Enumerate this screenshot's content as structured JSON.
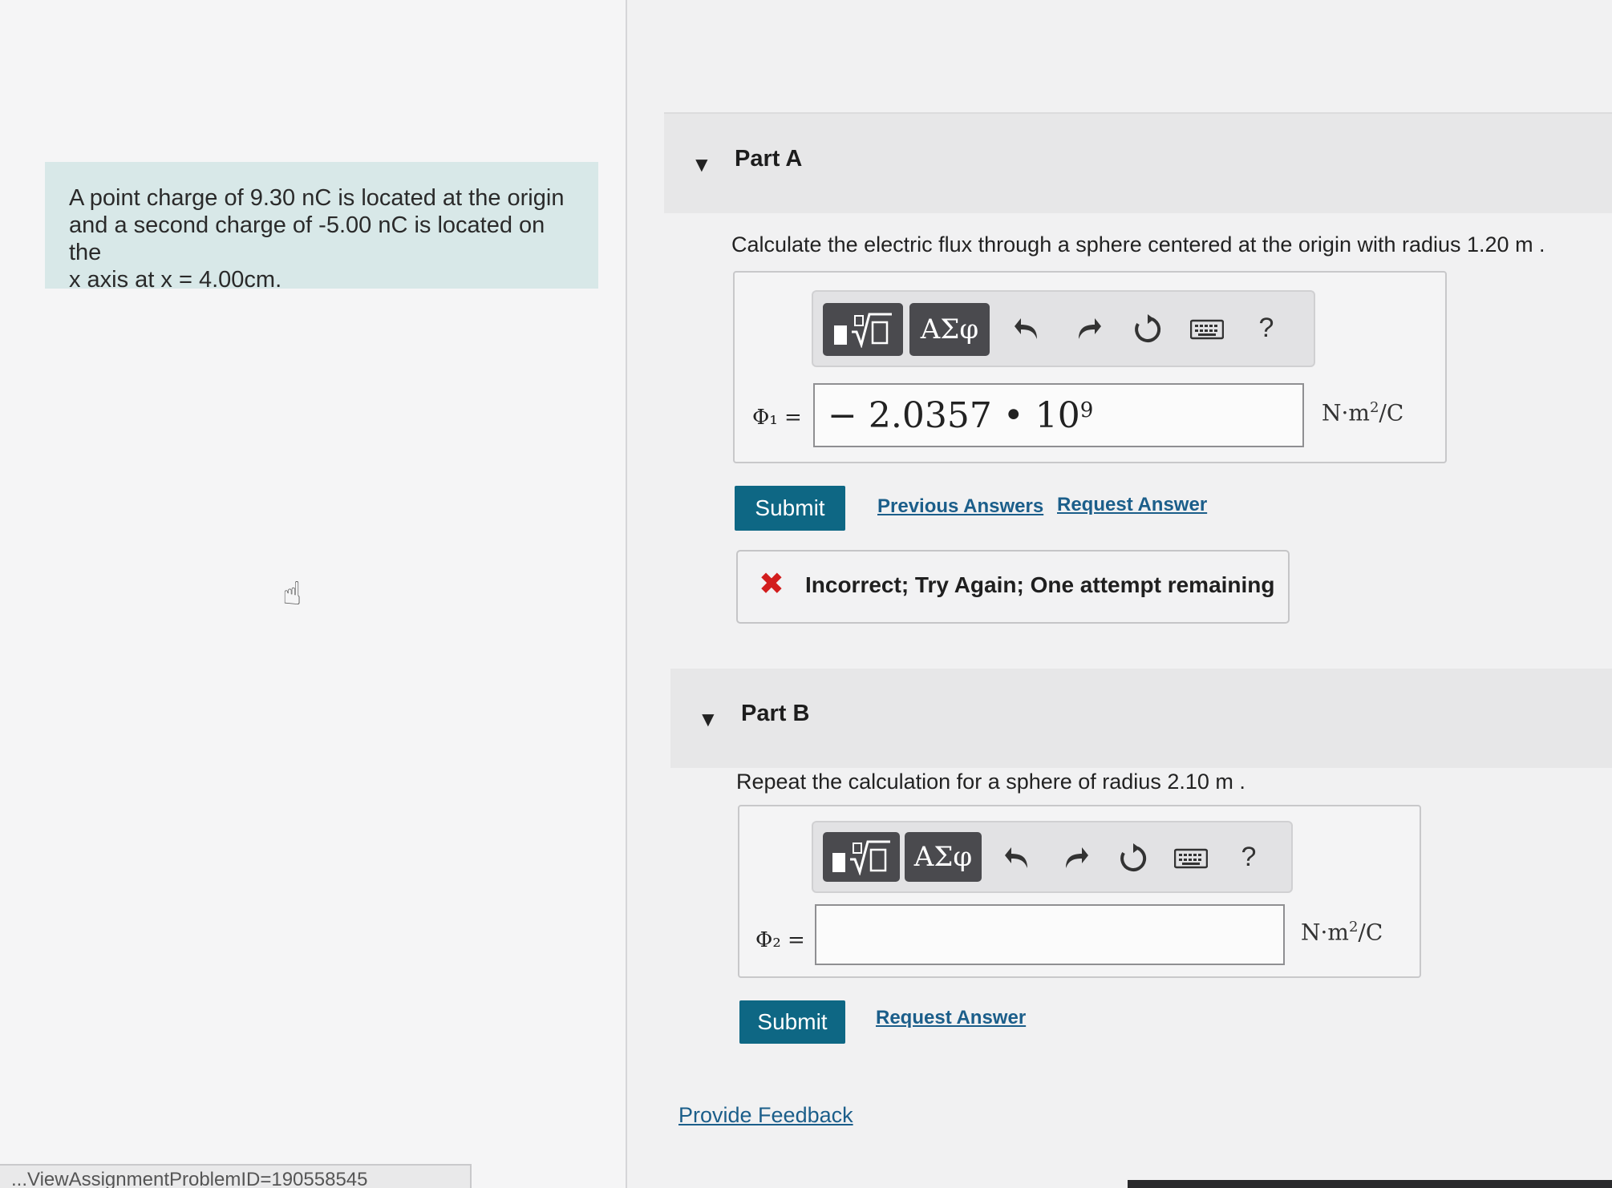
{
  "problem": {
    "line1": "A point charge of 9.30 nC is located at the origin",
    "line2": "and a second charge of -5.00 nC is located on the",
    "line3": "x axis at x = 4.00cm."
  },
  "url_fragment": "...ViewAssignmentProblemID=190558545",
  "toolbar": {
    "template_icon": "template-sqrt-icon",
    "greek_label": "ΑΣφ",
    "undo_icon": "undo-icon",
    "redo_icon": "redo-icon",
    "reset_icon": "reset-icon",
    "keyboard_icon": "keyboard-icon",
    "help_label": "?"
  },
  "part_a": {
    "title": "Part A",
    "prompt": "Calculate the electric flux through a sphere centered at the origin with radius 1.20 m .",
    "var_label": "Φ₁ =",
    "answer_mantissa": "− 2.0357 • 10",
    "answer_exponent": "9",
    "unit_base": "N·m",
    "unit_exp": "2",
    "unit_tail": "/C",
    "submit_label": "Submit",
    "previous_answers_label": "Previous Answers",
    "request_answer_label": "Request Answer",
    "feedback_message": "Incorrect; Try Again; One attempt remaining"
  },
  "part_b": {
    "title": "Part B",
    "prompt": "Repeat the calculation for a sphere of radius 2.10 m .",
    "var_label": "Φ₂ =",
    "answer_value": "",
    "unit_base": "N·m",
    "unit_exp": "2",
    "unit_tail": "/C",
    "submit_label": "Submit",
    "request_answer_label": "Request Answer"
  },
  "provide_feedback_label": "Provide Feedback",
  "colors": {
    "submit_bg": "#0e6784",
    "link": "#1b5e8a",
    "error_x": "#d21d1d",
    "problem_bg": "#d8e8e8"
  }
}
